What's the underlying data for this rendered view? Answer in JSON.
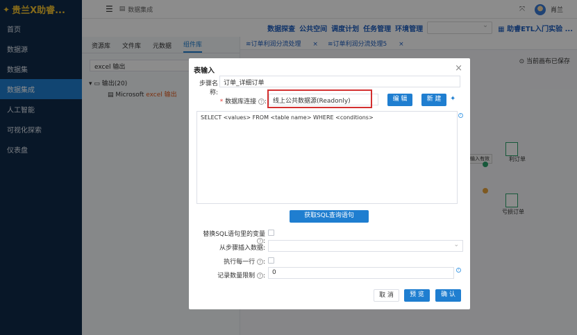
{
  "app": {
    "logo_text": "贵兰X助睿...",
    "breadcrumb": "数据集成",
    "username": "肖兰"
  },
  "sidebar": {
    "items": [
      {
        "label": "首页"
      },
      {
        "label": "数据源"
      },
      {
        "label": "数据集"
      },
      {
        "label": "数据集成"
      },
      {
        "label": "人工智能"
      },
      {
        "label": "可视化探索"
      },
      {
        "label": "仪表盘"
      }
    ]
  },
  "subnav": {
    "links": [
      "数据探查",
      "公共空间",
      "调度计划",
      "任务管理",
      "环境管理"
    ],
    "select_value": "",
    "guide": "助睿ETL入门实验 ..."
  },
  "repo": {
    "tabs": [
      "资源库",
      "文件库",
      "元数据",
      "组件库"
    ],
    "active_tab": "组件库",
    "search_value": "excel 输出",
    "tree_node": "输出(20)",
    "leaf_prefix": "Microsoft ",
    "leaf_highlight": "excel 输出"
  },
  "canvas": {
    "tabs": [
      "订单利润分流处理",
      "订单利润分流处理5"
    ],
    "saved_text": "当前画布已保存",
    "node1_label": "利订单",
    "node2_label": "亏损订单",
    "tooltip": "请输入有效"
  },
  "modal": {
    "title": "表输入",
    "step_name_label": "步骤名称:",
    "step_name_value": "订单_详细订单",
    "db_conn_label": "数据库连接",
    "db_conn_value": "线上公共数据源(Readonly)",
    "edit_button": "编 辑",
    "new_button": "新 建",
    "sql_text": "SELECT <values> FROM <table name> WHERE <conditions>",
    "get_sql_button": "获取SQL查询语句",
    "replace_var_label": "替换SQL语句里的变量",
    "insert_from_step_label": "从步骤插入数据",
    "execute_each_row_label": "执行每一行",
    "record_limit_label": "记录数量限制",
    "record_limit_value": "0",
    "cancel_button": "取 消",
    "preview_button": "预 览",
    "confirm_button": "确 认"
  },
  "colors": {
    "sidebar_bg": "#0f2a4a",
    "active": "#1f7ed0",
    "highlight_box": "#d32f2f",
    "link": "#1f5fbf"
  }
}
